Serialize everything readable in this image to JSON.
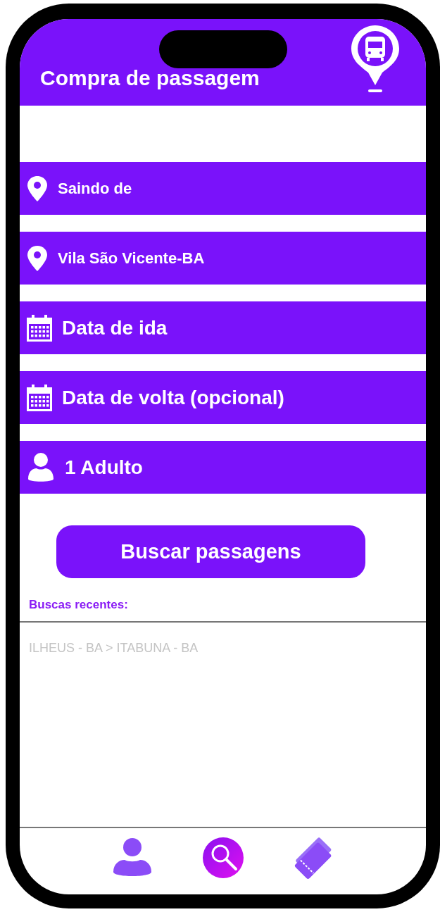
{
  "header": {
    "title": "Compra de passagem"
  },
  "fields": [
    {
      "kind": "location",
      "text": "Saindo de"
    },
    {
      "kind": "location",
      "text": "Vila São Vicente-BA"
    },
    {
      "kind": "date",
      "text": "Data de ida"
    },
    {
      "kind": "date",
      "text": "Data de volta (opcional)"
    },
    {
      "kind": "passenger",
      "text": "1 Adulto"
    }
  ],
  "search_button": "Buscar passagens",
  "recent": {
    "title": "Buscas recentes:",
    "items": [
      "ILHEUS - BA > ITABUNA - BA"
    ]
  },
  "bottom_nav": [
    {
      "kind": "profile",
      "selected": false
    },
    {
      "kind": "search",
      "selected": true
    },
    {
      "kind": "tickets",
      "selected": false
    }
  ]
}
